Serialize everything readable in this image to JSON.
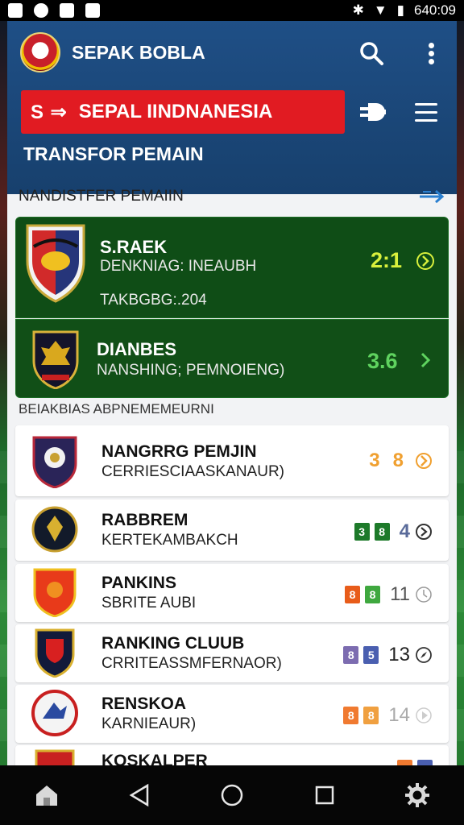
{
  "status_bar": {
    "time": "640:09"
  },
  "header": {
    "app_title": "SEPAK BOBLA",
    "banner_text": "SEPAL IINDNANESIA",
    "banner_mark": "S ⇒",
    "subtitle": "TRANSFOR PEMAIN"
  },
  "section1": {
    "title": "NANDISTFER PEMAIIN",
    "featured": [
      {
        "name": "S.RAEK",
        "line1": "DENKNIAG: INEAUBH",
        "line2": "TAKBGBG:.204",
        "score": "2:1",
        "score_color": "#d8f03c"
      },
      {
        "name": "DIANBES",
        "line1": "NANSHING; PEMNOIENG)",
        "score": "3.6",
        "score_color": "#5fd35f"
      }
    ]
  },
  "section2": {
    "title": "BEIAKBIAS ABPNEMEMEURNI",
    "items": [
      {
        "name": "NANGRRG PEMJIN",
        "sub": "CERRIESCIAASKANAUR)",
        "box1": "3",
        "box2": "8",
        "box1_color": "",
        "box2_color": "",
        "num": "",
        "num_color": "#f0a030"
      },
      {
        "name": "RABBREM",
        "sub": "KERTEKAMBAKCH",
        "box1": "3",
        "box2": "8",
        "box1_color": "#1d7a2a",
        "box2_color": "#1d7a2a",
        "num": "4",
        "num_color": "#5a6b9a"
      },
      {
        "name": "PANKINS",
        "sub": "SBRITE AUBI",
        "box1": "8",
        "box2": "8",
        "box1_color": "#e85c1a",
        "box2_color": "#3fa83f",
        "num": "11",
        "num_color": "#555"
      },
      {
        "name": "RANKING CLUUB",
        "sub": "CRRITEASSMFERNAOR)",
        "box1": "8",
        "box2": "5",
        "box1_color": "#7c6cb0",
        "box2_color": "#4a5fb0",
        "num": "13",
        "num_color": "#222"
      },
      {
        "name": "RENSKOA",
        "sub": "KARNIEAUR)",
        "box1": "8",
        "box2": "8",
        "box1_color": "#f07a30",
        "box2_color": "#f0a040",
        "num": "14",
        "num_color": "#aaa"
      },
      {
        "name": "KOSKALPER",
        "sub": "",
        "box1": "",
        "box2": "",
        "box1_color": "#f07a30",
        "box2_color": "#4a5fb0",
        "num": "",
        "num_color": "#aaa"
      }
    ]
  },
  "icons": {
    "search": "search-icon",
    "more": "more-vert-icon",
    "filter": "filter-icon",
    "menu": "menu-icon",
    "nav": [
      "home-icon",
      "back-icon",
      "home-circle-icon",
      "recents-icon",
      "settings-icon"
    ]
  }
}
